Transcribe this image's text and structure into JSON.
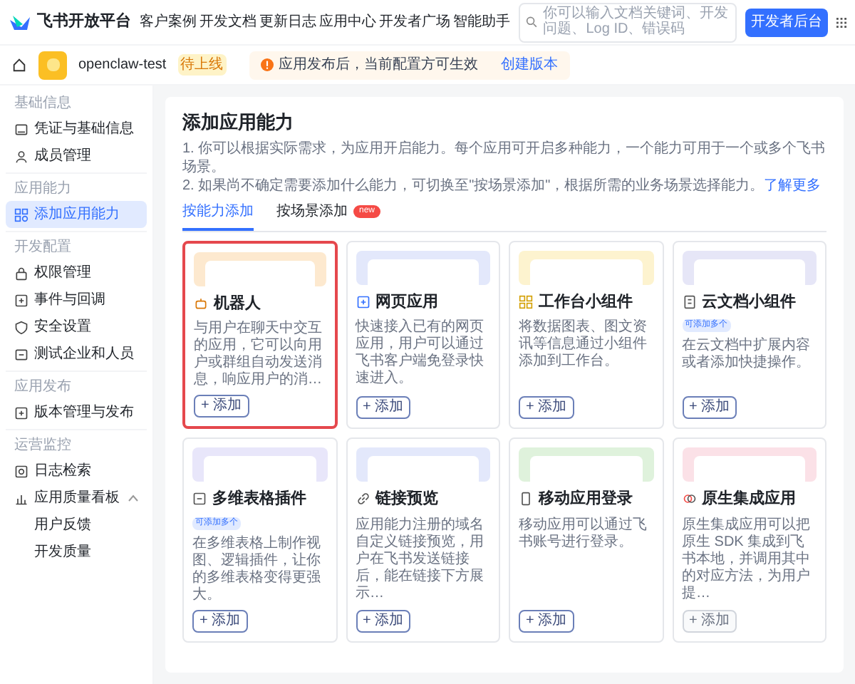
{
  "nav": {
    "brand": "飞书开放平台",
    "links": [
      "客户案例",
      "开发文档",
      "更新日志",
      "应用中心",
      "开发者广场",
      "智能助手"
    ],
    "search": {
      "placeholder": "你可以输入文档关键词、开发问题、Log ID、错误码"
    },
    "console_button": "开发者后台"
  },
  "app_bar": {
    "app_name": "openclaw-test",
    "status": "待上线",
    "notice": "应用发布后，当前配置方可生效",
    "notice_link": "创建版本"
  },
  "sidebar": [
    {
      "heading": "基础信息",
      "items": [
        {
          "label": "凭证与基础信息",
          "selected": false
        },
        {
          "label": "成员管理",
          "selected": false
        }
      ]
    },
    {
      "heading": "应用能力",
      "items": [
        {
          "label": "添加应用能力",
          "selected": true
        }
      ]
    },
    {
      "heading": "开发配置",
      "items": [
        {
          "label": "权限管理",
          "selected": false
        },
        {
          "label": "事件与回调",
          "selected": false
        },
        {
          "label": "安全设置",
          "selected": false
        },
        {
          "label": "测试企业和人员",
          "selected": false
        }
      ]
    },
    {
      "heading": "应用发布",
      "items": [
        {
          "label": "版本管理与发布",
          "selected": false
        }
      ]
    },
    {
      "heading": "运营监控",
      "items": [
        {
          "label": "日志检索",
          "selected": false
        },
        {
          "label": "应用质量看板",
          "selected": false,
          "expanded": true,
          "children": [
            {
              "label": "用户反馈",
              "selected": false
            },
            {
              "label": "开发质量",
              "selected": false
            }
          ]
        }
      ]
    }
  ],
  "main": {
    "title": "添加应用能力",
    "notes": [
      "1. 你可以根据实际需求，为应用开启能力。每个应用可开启多种能力，一个能力可用于一个或多个飞书场景。",
      "2. 如果尚不确定需要添加什么能力，可切换至\"按场景添加\"，根据所需的业务场景选择能力。"
    ],
    "learn_more": "了解更多",
    "tabs": [
      {
        "label": "按能力添加",
        "selected": true
      },
      {
        "label": "按场景添加",
        "selected": false,
        "badge": "new"
      }
    ],
    "cards": [
      {
        "title": "机器人",
        "description": "与用户在聊天中交互的应用，它可以向用户或群组自动发送消息，响应用户的消…",
        "color": "#fde9cf",
        "highlighted": true,
        "button": {
          "label": "+ 添加",
          "disabled": false
        }
      },
      {
        "title": "网页应用",
        "description": "快速接入已有的网页应用，用户可以通过飞书客户端免登录快速进入。",
        "color": "#e3e8fb",
        "highlighted": false,
        "button": {
          "label": "+ 添加",
          "disabled": false
        }
      },
      {
        "title": "工作台小组件",
        "description": "将数据图表、图文资讯等信息通过小组件添加到工作台。",
        "color": "#fdf3cf",
        "highlighted": false,
        "button": {
          "label": "+ 添加",
          "disabled": false
        }
      },
      {
        "title": "云文档小组件",
        "tag": "可添加多个",
        "description": "在云文档中扩展内容或者添加快捷操作。",
        "color": "#e6e6f7",
        "highlighted": false,
        "button": {
          "label": "+ 添加",
          "disabled": false
        }
      },
      {
        "title": "多维表格插件",
        "tag": "可添加多个",
        "description": "在多维表格上制作视图、逻辑插件，让你的多维表格变得更强大。",
        "color": "#e8e6fa",
        "highlighted": false,
        "button": {
          "label": "+ 添加",
          "disabled": false
        }
      },
      {
        "title": "链接预览",
        "description": "应用能力注册的域名自定义链接预览，用户在飞书发送链接后，能在链接下方展示…",
        "color": "#e3e8fb",
        "highlighted": false,
        "button": {
          "label": "+ 添加",
          "disabled": false
        }
      },
      {
        "title": "移动应用登录",
        "description": "移动应用可以通过飞书账号进行登录。",
        "color": "#dff2dc",
        "highlighted": false,
        "button": {
          "label": "+ 添加",
          "disabled": false
        }
      },
      {
        "title": "原生集成应用",
        "description": "原生集成应用可以把原生 SDK 集成到飞书本地，并调用其中的对应方法，为用户提…",
        "color": "#fbe1e7",
        "highlighted": false,
        "button": {
          "label": "+ 添加",
          "disabled": true
        }
      }
    ]
  }
}
